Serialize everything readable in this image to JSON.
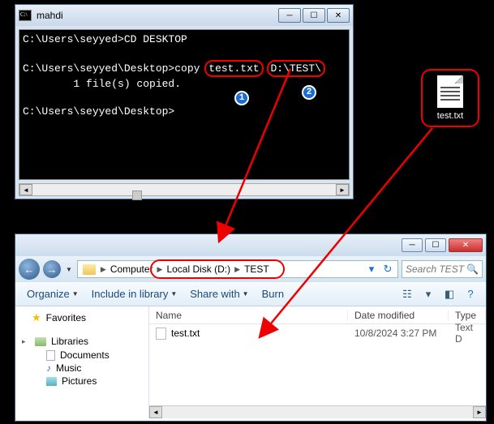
{
  "cmd": {
    "title": "mahdi",
    "line1_prompt": "C:\\Users\\seyyed>",
    "line1_cmd": "CD DESKTOP",
    "line2_prompt": "C:\\Users\\seyyed\\Desktop>",
    "line2_cmd": "copy",
    "line2_arg1": "test.txt",
    "line2_arg2": "D:\\TEST\\",
    "line3": "        1 file(s) copied.",
    "line4_prompt": "C:\\Users\\seyyed\\Desktop>",
    "badge1": "1",
    "badge2": "2"
  },
  "desktop_file": {
    "label": "test.txt"
  },
  "explorer": {
    "address": {
      "seg1": "Computer",
      "seg2": "Local Disk (D:)",
      "seg3": "TEST"
    },
    "search_placeholder": "Search TEST",
    "toolbar": {
      "organize": "Organize",
      "include": "Include in library",
      "share": "Share with",
      "burn": "Burn"
    },
    "sidebar": {
      "favorites": "Favorites",
      "libraries": "Libraries",
      "documents": "Documents",
      "music": "Music",
      "pictures": "Pictures"
    },
    "columns": {
      "name": "Name",
      "date": "Date modified",
      "type": "Type"
    },
    "files": [
      {
        "name": "test.txt",
        "date": "10/8/2024 3:27 PM",
        "type": "Text D"
      }
    ]
  }
}
